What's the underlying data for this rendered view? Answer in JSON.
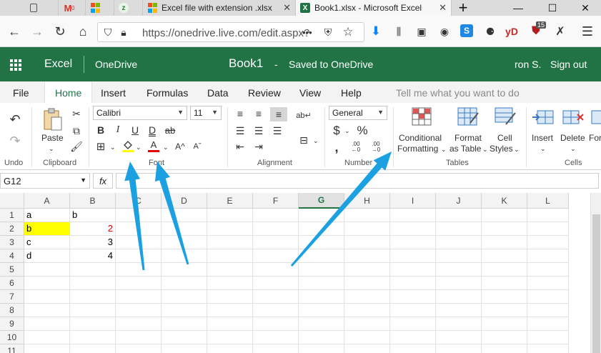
{
  "browser": {
    "tabs": [
      {
        "label": "",
        "icon": "pocket-icon"
      },
      {
        "label": "",
        "icon": "gmail-icon",
        "badge": "0"
      },
      {
        "label": "",
        "icon": "microsoft-icon"
      },
      {
        "label": "",
        "icon": "zoho-icon"
      },
      {
        "label": "Excel file with extension .xlsx",
        "icon": "microsoft-icon"
      },
      {
        "label": "Book1.xlsx - Microsoft Excel",
        "icon": "excel-icon"
      }
    ],
    "new_tab": "+",
    "url": "https://onedrive.live.com/edit.aspx?",
    "url_domain": "live.com",
    "more": "•••",
    "ext_yd": "yD",
    "ext_badge": "15"
  },
  "app": {
    "waffle_icon": "waffle-icon",
    "name": "Excel",
    "service": "OneDrive",
    "doc_title": "Book1",
    "dash": "-",
    "save_status": "Saved to OneDrive",
    "user": "ron S.",
    "sign_out": "Sign out",
    "brand_color": "#217346"
  },
  "ribbon_tabs": [
    "File",
    "Home",
    "Insert",
    "Formulas",
    "Data",
    "Review",
    "View",
    "Help"
  ],
  "tell_me": "Tell me what you want to do",
  "ribbon": {
    "undo": "Undo",
    "paste": "Paste",
    "clipboard": "Clipboard",
    "font_name": "Calibri",
    "font_size": "11",
    "bold": "B",
    "italic": "I",
    "underline": "U",
    "double_underline": "D",
    "strike": "ab",
    "grow": "A^",
    "shrink": "Aˇ",
    "font_color_letter": "A",
    "font_group": "Font",
    "alignment": "Alignment",
    "number_format": "General",
    "currency": "$",
    "percent": "%",
    "comma": ",",
    "dec_inc": ".00",
    "dec_dec": ".00",
    "number_group": "Number",
    "conditional_formatting": [
      "Conditional",
      "Formatting"
    ],
    "format_as_table": [
      "Format",
      "as Table"
    ],
    "cell_styles": [
      "Cell",
      "Styles"
    ],
    "tables_group": "Tables",
    "insert": "Insert",
    "delete": "Delete",
    "format": "For",
    "cells_group": "Cells"
  },
  "formula_bar": {
    "name_box": "G12",
    "fx": "fx",
    "formula": ""
  },
  "grid": {
    "columns": [
      "A",
      "B",
      "C",
      "D",
      "E",
      "F",
      "G",
      "H",
      "I",
      "J",
      "K",
      "L"
    ],
    "selected_column": "G",
    "rows": [
      "1",
      "2",
      "3",
      "4",
      "5",
      "6",
      "7",
      "8",
      "9",
      "10",
      "11"
    ],
    "cells": [
      {
        "ref": "A1",
        "value": "a",
        "num": false
      },
      {
        "ref": "B1",
        "value": "b",
        "num": false
      },
      {
        "ref": "A2",
        "value": "b",
        "num": false,
        "fill": "#ffff00"
      },
      {
        "ref": "B2",
        "value": "2",
        "num": true,
        "color": "#e00000"
      },
      {
        "ref": "A3",
        "value": "c",
        "num": false
      },
      {
        "ref": "B3",
        "value": "3",
        "num": true
      },
      {
        "ref": "A4",
        "value": "d",
        "num": false
      },
      {
        "ref": "B4",
        "value": "4",
        "num": true
      }
    ]
  },
  "annotation_color": "#1ba1e2"
}
